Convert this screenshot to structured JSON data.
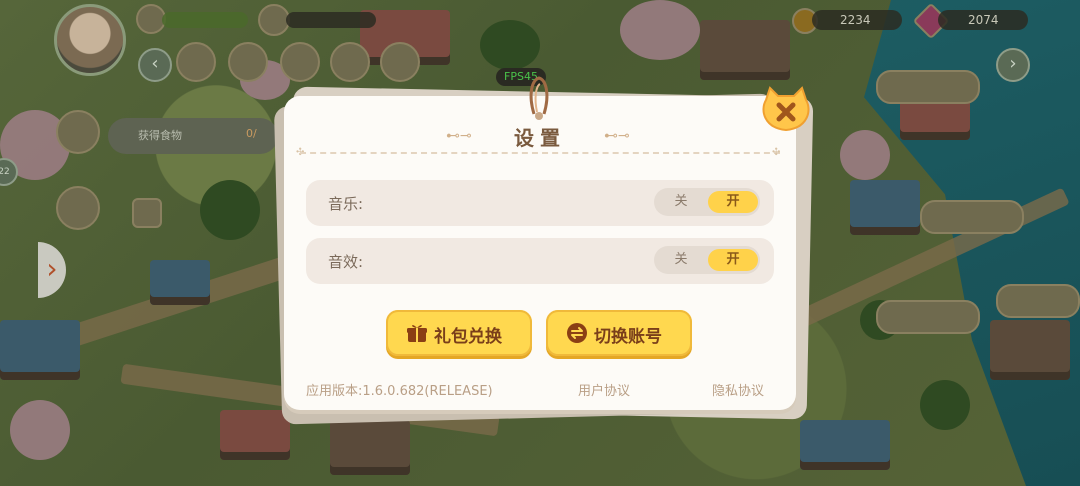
{
  "hud": {
    "coins": "2234",
    "gems": "2074",
    "quest": "获得食物",
    "quest_progress": "0/",
    "left_badge": "22"
  },
  "overlay": {
    "fps": "FPS45"
  },
  "settings": {
    "title": "设置",
    "music_label": "音乐:",
    "sound_label": "音效:",
    "off_label": "关",
    "on_label": "开",
    "music_on": true,
    "sound_on": true,
    "gift_button": "礼包兑换",
    "switch_button": "切换账号",
    "version": "应用版本:1.6.0.682(RELEASE)",
    "user_agreement": "用户协议",
    "privacy_agreement": "隐私协议"
  },
  "icons": {
    "gift": "gift-icon",
    "switch": "switch-account-icon",
    "close": "cat-close-icon"
  },
  "colors": {
    "accent_button": "#ffd84f",
    "toggle_on": "#ffd24a",
    "title_text": "#7a5a3e",
    "fps_text": "#4ac24a"
  }
}
